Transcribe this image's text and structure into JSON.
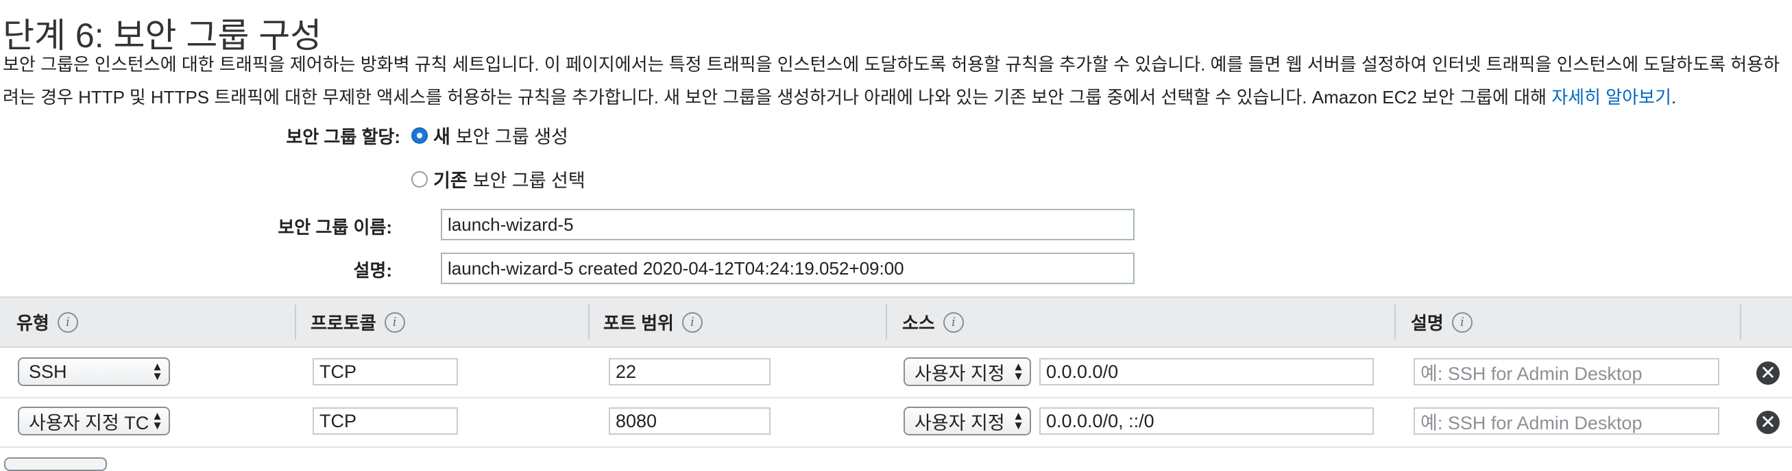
{
  "page": {
    "title": "단계 6: 보안 그룹 구성",
    "description": "보안 그룹은 인스턴스에 대한 트래픽을 제어하는 방화벽 규칙 세트입니다. 이 페이지에서는 특정 트래픽을 인스턴스에 도달하도록 허용할 규칙을 추가할 수 있습니다. 예를 들면 웹 서버를 설정하여 인터넷 트래픽을 인스턴스에 도달하도록 허용하려는 경우 HTTP 및 HTTPS 트래픽에 대한 무제한 액세스를 허용하는 규칙을 추가합니다. 새 보안 그룹을 생성하거나 아래에 나와 있는 기존 보안 그룹 중에서 선택할 수 있습니다. Amazon EC2 보안 그룹에 대해 ",
    "learn_more_link": "자세히 알아보기",
    "description_end": "."
  },
  "form": {
    "assign_label": "보안 그룹 할당:",
    "option_new_bold": "새",
    "option_new_rest": "보안 그룹 생성",
    "option_existing_bold": "기존",
    "option_existing_rest": "보안 그룹 선택",
    "selected_option": "new",
    "name_label": "보안 그룹 이름:",
    "name_value": "launch-wizard-5",
    "desc_label": "설명:",
    "desc_value": "launch-wizard-5 created 2020-04-12T04:24:19.052+09:00"
  },
  "table": {
    "headers": [
      "유형",
      "프로토콜",
      "포트 범위",
      "소스",
      "설명"
    ],
    "info_icon_glyph": "i",
    "rows": [
      {
        "type": "SSH",
        "protocol": "TCP",
        "port": "22",
        "source_type": "사용자 지정",
        "source_value": "0.0.0.0/0",
        "description_placeholder": "예: SSH for Admin Desktop"
      },
      {
        "type": "사용자 지정 TC",
        "protocol": "TCP",
        "port": "8080",
        "source_type": "사용자 지정",
        "source_value": "0.0.0.0/0, ::/0",
        "description_placeholder": "예: SSH for Admin Desktop"
      }
    ],
    "remove_icon_glyph": "✕"
  },
  "colors": {
    "link": "#0066c0",
    "radio_selected": "#1e77d6",
    "header_bg": "#e9ebed"
  }
}
